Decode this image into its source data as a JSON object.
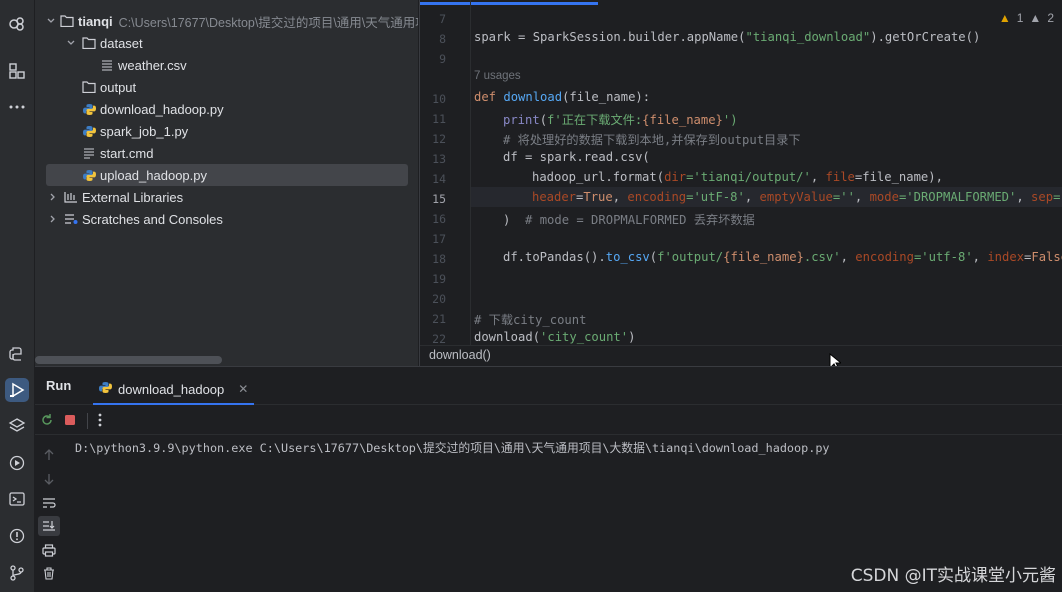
{
  "project": {
    "root_name": "tianqi",
    "root_path": "C:\\Users\\17677\\Desktop\\提交过的项目\\通用\\天气通用项",
    "items": [
      {
        "label": "dataset"
      },
      {
        "label": "weather.csv"
      },
      {
        "label": "output"
      },
      {
        "label": "download_hadoop.py"
      },
      {
        "label": "spark_job_1.py"
      },
      {
        "label": "start.cmd"
      },
      {
        "label": "upload_hadoop.py"
      },
      {
        "label": "External Libraries"
      },
      {
        "label": "Scratches and Consoles"
      }
    ]
  },
  "editor": {
    "line_numbers": [
      "7",
      "8",
      "9",
      "10",
      "11",
      "12",
      "13",
      "14",
      "15",
      "16",
      "17",
      "18",
      "19",
      "20",
      "21",
      "22"
    ],
    "usages_hint": "7 usages",
    "warnings": {
      "warn_count": "1",
      "weak_count": "2"
    },
    "code": {
      "l8": {
        "a": "spark = SparkSession.builder.appName(",
        "b": "\"tianqi_download\"",
        "c": ").getOrCreate()"
      },
      "l10": {
        "kw": "def ",
        "fn": "download",
        "rest": "(file_name):"
      },
      "l11": {
        "bi": "print",
        "a": "(",
        "b": "f'正在下载文件:",
        "c": "{file_name}",
        "d": "')"
      },
      "l12": "# 将处理好的数据下载到本地,并保存到output目录下",
      "l13": "df = spark.read.csv(",
      "l14": {
        "a": "hadoop_url.format(",
        "p1": "dir",
        "s1": "='tianqi/output/'",
        "c": ", ",
        "p2": "file",
        "d": "=file_name),"
      },
      "l15": {
        "p1": "header",
        "a": "=",
        "kw1": "True",
        "b": ", ",
        "p2": "encoding",
        "s1": "='utF-8'",
        "c": ", ",
        "p3": "emptyValue",
        "s2": "=''",
        "d": ", ",
        "p4": "mode",
        "s3": "='DROPMALFORMED'",
        "e": ", ",
        "p5": "sep",
        "s4": "='"
      },
      "l16": {
        "a": ")  ",
        "cm": "# mode = DROPMALFORMED 丢弃坏数据"
      },
      "l18": {
        "a": "df.toPandas().",
        "fn": "to_csv",
        "b": "(",
        "s1": "f'output/",
        "c": "{file_name}",
        "s2": ".csv'",
        "d": ", ",
        "p1": "encoding",
        "s3": "='utf-8'",
        "e": ", ",
        "p2": "index",
        "f": "=",
        "kw1": "False"
      },
      "l21": "# 下载city_count",
      "l22": {
        "a": "download(",
        "s": "'city_count'",
        "b": ")"
      }
    },
    "breadcrumb": "download()"
  },
  "run": {
    "title": "Run",
    "tab_label": "download_hadoop",
    "console_line": "D:\\python3.9.9\\python.exe C:\\Users\\17677\\Desktop\\提交过的项目\\通用\\天气通用项目\\大数据\\tianqi\\download_hadoop.py"
  },
  "watermark": "CSDN @IT实战课堂小元酱"
}
